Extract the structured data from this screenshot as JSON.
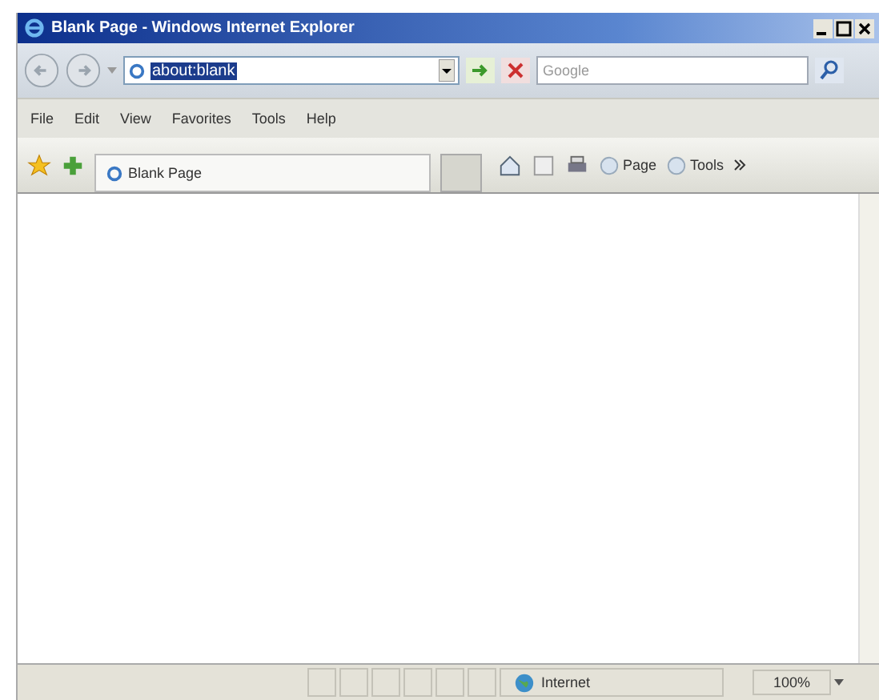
{
  "window": {
    "title": "Blank Page - Windows Internet Explorer"
  },
  "address": {
    "value": "about:blank",
    "selected": true
  },
  "search": {
    "placeholder": "Google"
  },
  "menu": [
    "File",
    "Edit",
    "View",
    "Favorites",
    "Tools",
    "Help"
  ],
  "tab": {
    "label": "Blank Page",
    "selected": true
  },
  "toolbar_buttons": [
    {
      "label": "Page"
    },
    {
      "label": "Tools"
    }
  ],
  "status_bar": {
    "zone": "Internet",
    "zoom": "100%"
  }
}
